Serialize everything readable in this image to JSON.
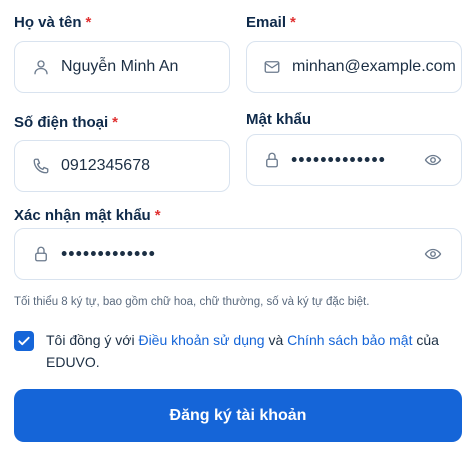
{
  "form": {
    "full_name": {
      "label": "Họ và tên",
      "required_mark": "*",
      "value": "Nguyễn Minh An",
      "icon": "user-icon"
    },
    "email": {
      "label": "Email",
      "required_mark": "*",
      "value": "minhan@example.com",
      "icon": "mail-icon"
    },
    "phone": {
      "label": "Số điện thoại",
      "required_mark": "*",
      "value": "0912345678",
      "icon": "phone-icon"
    },
    "password": {
      "label": "Mật khẩu",
      "value": "•••••••••••••",
      "icon": "lock-icon",
      "toggle_icon": "eye-icon"
    },
    "confirm_password": {
      "label": "Xác nhận mật khẩu",
      "required_mark": "*",
      "value": "•••••••••••••",
      "icon": "lock-icon",
      "toggle_icon": "eye-icon"
    },
    "password_hint": "Tối thiểu 8 ký tự, bao gồm chữ hoa, chữ thường, số và ký tự đặc biệt.",
    "agreement": {
      "checked": true,
      "prefix": "Tôi đồng ý với ",
      "terms_link": "Điều khoản sử dụng",
      "middle": " và ",
      "privacy_link": "Chính sách bảo mật",
      "suffix": " của EDUVO."
    },
    "submit_label": "Đăng ký tài khoản"
  },
  "colors": {
    "accent": "#1565d8",
    "required": "#e03131",
    "border": "#d9e3ef",
    "text": "#0f2a4a"
  }
}
